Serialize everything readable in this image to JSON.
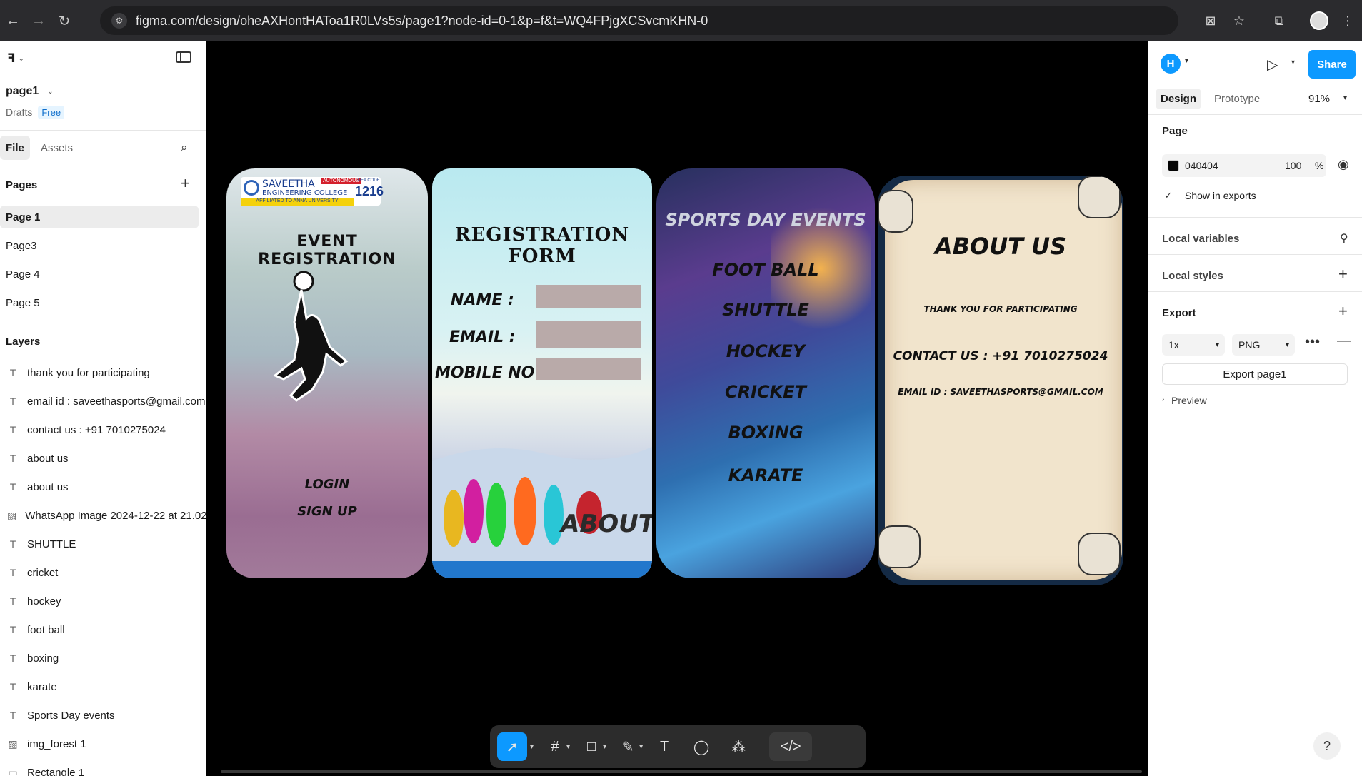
{
  "browser": {
    "url": "figma.com/design/oheAXHontHAToa1R0LVs5s/page1?node-id=0-1&p=f&t=WQ4FPjgXCSvcmKHN-0"
  },
  "file": {
    "name": "page1",
    "location": "Drafts",
    "plan": "Free"
  },
  "left_tabs": {
    "file": "File",
    "assets": "Assets"
  },
  "pages": {
    "heading": "Pages",
    "items": [
      "Page 1",
      "Page3",
      "Page 4",
      "Page 5"
    ]
  },
  "layers": {
    "heading": "Layers",
    "items": [
      {
        "name": "thank you for participating",
        "kind": "text"
      },
      {
        "name": "email id : saveethasports@gmail.com",
        "kind": "text"
      },
      {
        "name": "contact us : +91 7010275024",
        "kind": "text"
      },
      {
        "name": "about us",
        "kind": "text"
      },
      {
        "name": "about us",
        "kind": "text"
      },
      {
        "name": "WhatsApp Image 2024-12-22 at 21.02",
        "kind": "image"
      },
      {
        "name": "SHUTTLE",
        "kind": "text"
      },
      {
        "name": "cricket",
        "kind": "text"
      },
      {
        "name": "hockey",
        "kind": "text"
      },
      {
        "name": "foot ball",
        "kind": "text"
      },
      {
        "name": "boxing",
        "kind": "text"
      },
      {
        "name": "karate",
        "kind": "text"
      },
      {
        "name": "Sports Day events",
        "kind": "text"
      },
      {
        "name": "img_forest 1",
        "kind": "image"
      },
      {
        "name": "Rectangle 1",
        "kind": "rect"
      }
    ]
  },
  "right": {
    "avatar_initial": "H",
    "share": "Share",
    "tabs": {
      "design": "Design",
      "prototype": "Prototype"
    },
    "zoom": "91%",
    "page_heading": "Page",
    "page_color": "040404",
    "page_opacity": "100",
    "percent": "%",
    "show_in_exports": "Show in exports",
    "local_variables": "Local variables",
    "local_styles": "Local styles",
    "export_heading": "Export",
    "export_scale": "1x",
    "export_format": "PNG",
    "export_button": "Export page1",
    "preview": "Preview"
  },
  "frames": {
    "registration": {
      "college_line1": "SAVEETHA",
      "college_line2": "ENGINEERING COLLEGE",
      "badge": "AUTONOMOUS",
      "affiliation": "AFFILIATED TO ANNA UNIVERSITY",
      "code_label": "TNEA CODE",
      "code": "1216",
      "title": "EVENT REGISTRATION",
      "login": "LOGIN",
      "signup": "SIGN UP"
    },
    "form": {
      "title": "REGISTRATION FORM",
      "name_label": "NAME :",
      "email_label": "EMAIL :",
      "mobile_label": "MOBILE NO :",
      "overlay": "ABOUT US"
    },
    "events": {
      "title": "SPORTS DAY EVENTS",
      "items": [
        "FOOT BALL",
        "SHUTTLE",
        "HOCKEY",
        "CRICKET",
        "BOXING",
        "KARATE"
      ]
    },
    "about": {
      "title": "ABOUT US",
      "thanks": "THANK YOU FOR PARTICIPATING",
      "contact": "CONTACT US : +91 7010275024",
      "email": "EMAIL ID : SAVEETHASPORTS@GMAIL.COM"
    }
  }
}
